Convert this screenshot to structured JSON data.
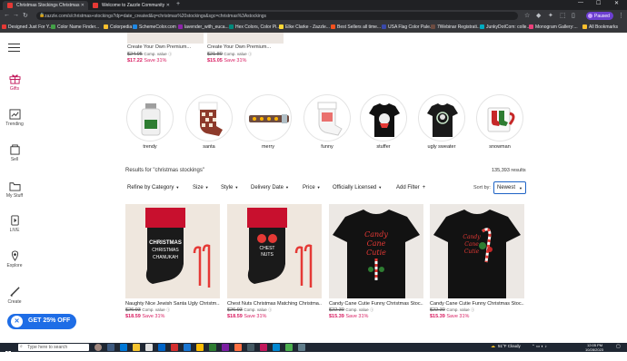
{
  "browser": {
    "tabs": [
      {
        "title": "Christmas Stockings Christmas",
        "active": true
      },
      {
        "title": "Welcome to Zazzle Community",
        "active": false
      }
    ],
    "url": "zazzle.com/s/christmas+stockings?dp=date_created&q=christmas%20stockings&sgc=christmas%3Astockings",
    "profile_label": "Paused",
    "bookmarks": [
      "Designed Just For Y...",
      "Color Name Finder...",
      "Colorpedia",
      "SchemeColor.com",
      "lavender_with_euca...",
      "Hex Colors, Color Pi...",
      "Elke Clarke - Zazzle...",
      "Best Sellers all time...",
      "USA Flag Color Pale...",
      "7Webinar Registrati...",
      "JunkyDotCom: colle...",
      "Monogram Gallery:...",
      "All Bookmarks"
    ]
  },
  "sidebar": {
    "items": [
      {
        "label": "Gifts",
        "icon": "gift-icon"
      },
      {
        "label": "Trending",
        "icon": "trending-icon"
      },
      {
        "label": "Sell",
        "icon": "sell-icon"
      },
      {
        "label": "My Stuff",
        "icon": "folder-icon"
      },
      {
        "label": "LIVE",
        "icon": "live-icon"
      },
      {
        "label": "Explore",
        "icon": "explore-icon"
      },
      {
        "label": "Create",
        "icon": "create-icon"
      }
    ]
  },
  "top_products": [
    {
      "title": "Create Your Own Premium...",
      "original": "$24.95",
      "comp": "Comp. value",
      "sale": "$17.22",
      "save": "Save 31%"
    },
    {
      "title": "Create Your Own Premium...",
      "original": "$21.80",
      "comp": "Comp. value",
      "sale": "$15.05",
      "save": "Save 31%"
    }
  ],
  "categories": [
    "trendy",
    "santa",
    "merry",
    "funny",
    "stuffer",
    "ugly sweater",
    "snowman"
  ],
  "results": {
    "label": "Results for \"christmas stockings\"",
    "count": "135,393 results"
  },
  "filters": [
    "Refine by Category",
    "Size",
    "Style",
    "Delivery Date",
    "Price",
    "Officially Licensed",
    "Add Filter"
  ],
  "sort": {
    "label": "Sort by:",
    "value": "Newest"
  },
  "products": [
    {
      "title": "Naughty Nice Jewish Santa Ugly Christm...",
      "original": "$26.93",
      "comp": "Comp. value",
      "sale": "$18.59",
      "save": "Save 31%",
      "art_text": [
        "CHRISTMAS",
        "CHRISTMAS",
        "CHANUKAH"
      ]
    },
    {
      "title": "Chest Nuts Christmas Matching Christma...",
      "original": "$26.93",
      "comp": "Comp. value",
      "sale": "$18.59",
      "save": "Save 31%",
      "art_text": [
        "CHEST",
        "NUTS"
      ]
    },
    {
      "title": "Candy Cane Cutie Funny Christmas Stoc...",
      "original": "$22.30",
      "comp": "Comp. value",
      "sale": "$15.39",
      "save": "Save 31%",
      "art_text": [
        "Candy",
        "Cane",
        "Cutie"
      ]
    },
    {
      "title": "Candy Cane Cutie Funny Christmas Stoc...",
      "original": "$22.30",
      "comp": "Comp. value",
      "sale": "$15.39",
      "save": "Save 31%",
      "art_text": [
        "Candy",
        "Cane",
        "Cutie"
      ]
    }
  ],
  "promo": {
    "label": "GET 25% OFF"
  },
  "taskbar": {
    "search_placeholder": "Type here to search",
    "weather": "51°F  Cloudy",
    "time": "12:05 PM",
    "date": "10/28/2023"
  },
  "colors": {
    "accent": "#c2185b",
    "sale": "#d81b60",
    "promo": "#1e6de6",
    "stocking_red": "#c8102e"
  }
}
